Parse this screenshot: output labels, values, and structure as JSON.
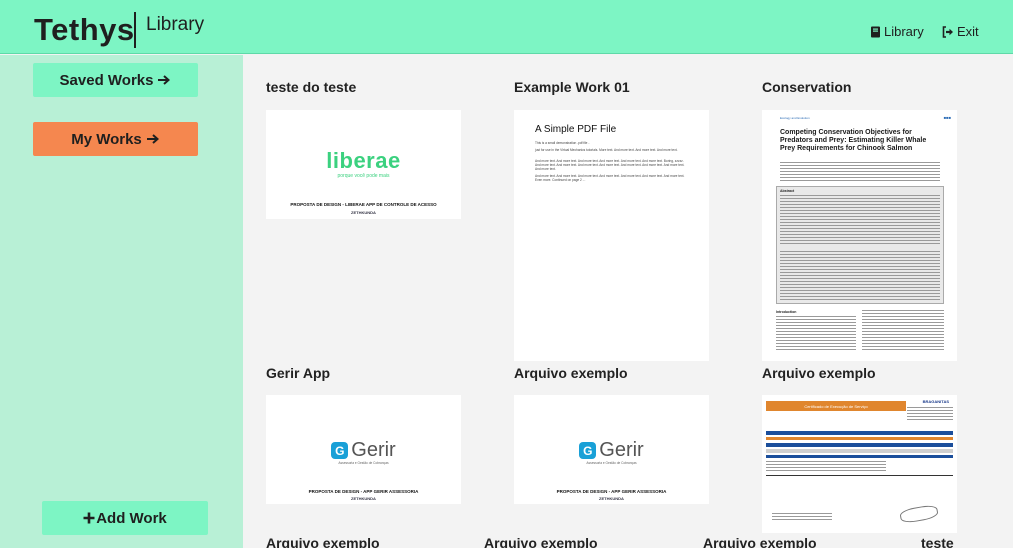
{
  "header": {
    "brand": "Tethys",
    "subtitle": "Library",
    "library_link": "Library",
    "exit_link": "Exit"
  },
  "sidebar": {
    "saved_works": "Saved Works",
    "my_works": "My Works",
    "add_work": "Add Work"
  },
  "works": [
    {
      "title": "teste do teste",
      "preview": {
        "logo": "liberae",
        "tagline": "porque você pode mais",
        "caption": "PROPOSTA DE DESIGN - LIBERAE APP DE CONTROLE DE ACESSO",
        "mark": "ZETHKUNDA"
      }
    },
    {
      "title": "Example Work 01",
      "preview": {
        "heading": "A Simple PDF File",
        "lines": [
          "This is a small demonstration .pdf file -",
          "just for use in the Virtual Mechanics tutorials. More text. And more text. And more text. And more text.",
          "And more text. And more text. And more text. And more text. And more text. And more text. Boring, zzzzz. And more text. And more text. And more text. And more text. And more text. And more text. And more text. And more text.",
          "And more text. And more text. And more text. And more text. And more text. And more text. And more text. Even more. Continued on page 2 ..."
        ]
      }
    },
    {
      "title": "Conservation",
      "preview": {
        "journal": "Ecology and Evolution",
        "heading": "Competing Conservation Objectives for Predators and Prey: Estimating Killer Whale Prey Requirements for Chinook Salmon",
        "abstract_label": "Abstract",
        "intro_label": "Introduction"
      }
    },
    {
      "title": "Gerir App",
      "preview": {
        "logo": "Gerir",
        "tagline": "Assessoria e Gestão de Cobranças",
        "caption": "PROPOSTA DE DESIGN - APP GERIR ASSESSORIA",
        "mark": "ZETHKUNDA"
      }
    },
    {
      "title": "Arquivo exemplo",
      "preview": {
        "logo": "Gerir",
        "tagline": "Assessoria e Gestão de Cobranças",
        "caption": "PROPOSTA DE DESIGN - APP GERIR ASSESSORIA",
        "mark": "ZETHKUNDA"
      }
    },
    {
      "title": "Arquivo exemplo",
      "preview": {
        "banner": "Certificado de Execução de Serviço",
        "brand": "BRAGANITAS"
      }
    }
  ],
  "next_row_titles": [
    "Arquivo exemplo",
    "Arquivo exemplo",
    "Arquivo exemplo",
    "teste"
  ],
  "colors": {
    "topbar": "#7df5c4",
    "sidebar": "#b8f0d6",
    "primary_button": "#7df5c4",
    "active_button": "#f5874f",
    "content_bg": "#f3f3f3"
  },
  "icons": {
    "library": "book-icon",
    "exit": "sign-out-icon",
    "saved_arrow": "arrow-right-icon",
    "my_arrow": "arrow-right-icon",
    "add": "plus-icon"
  }
}
